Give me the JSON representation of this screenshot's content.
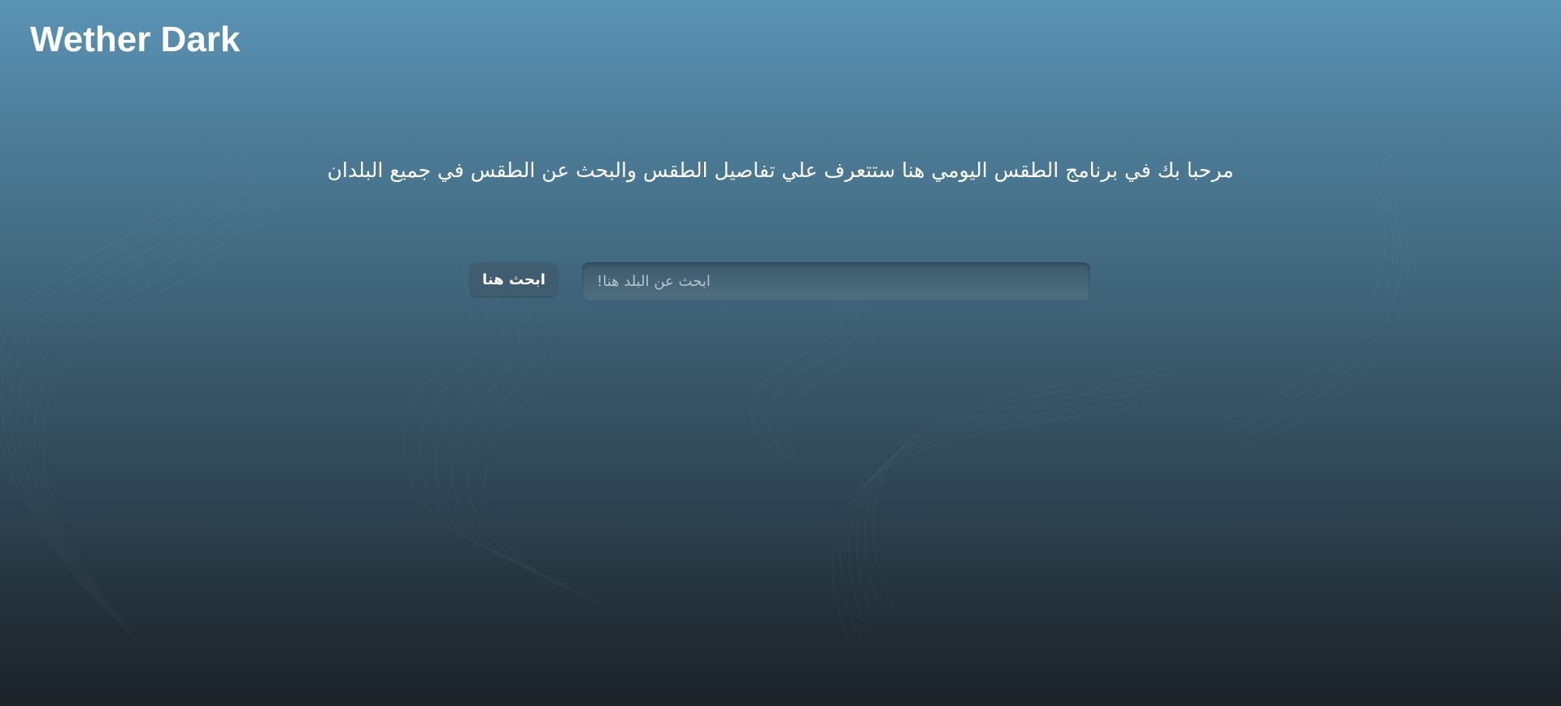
{
  "header": {
    "brand": "Wether Dark"
  },
  "main": {
    "welcome_text": "مرحبا بك في برنامج الطقس اليومي هنا ستتعرف علي تفاصيل الطقس والبحث عن الطقس في جميع البلدان"
  },
  "search": {
    "button_label": "ابحث هنا",
    "placeholder": "ابحث عن البلد هنا!",
    "value": ""
  },
  "colors": {
    "gradient_top": "#5b93b5",
    "gradient_bottom": "#1b2329",
    "button_bg": "#3f5d6e",
    "text": "#ffffff"
  }
}
